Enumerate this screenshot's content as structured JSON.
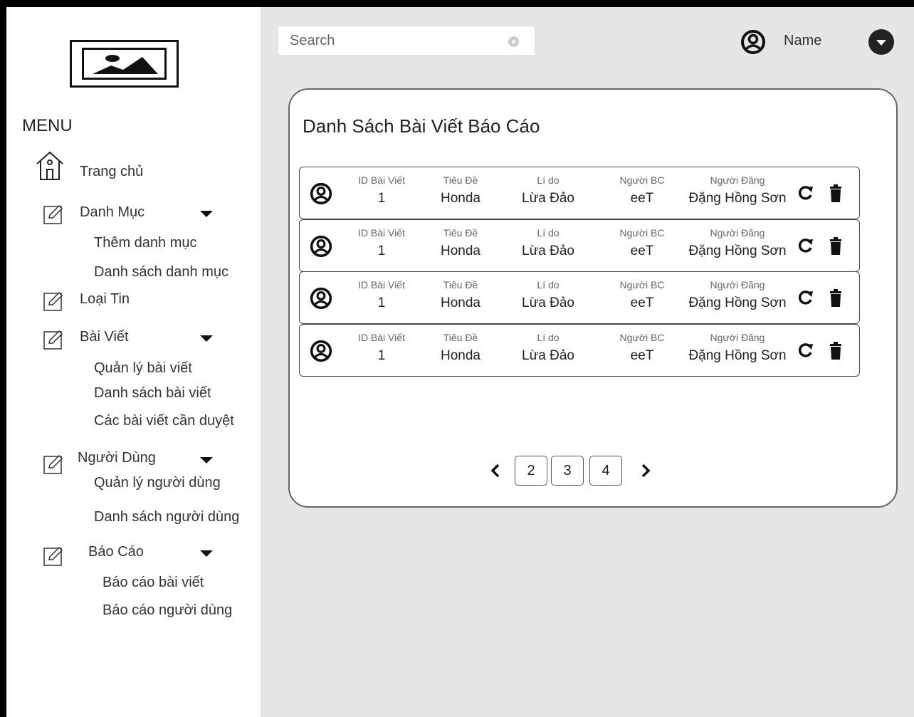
{
  "sidebar": {
    "menu_title": "MENU",
    "home_label": "Trang chủ",
    "categories": {
      "label": "Danh Mục",
      "items": [
        "Thêm danh mục",
        "Danh sách danh mục"
      ]
    },
    "news_type_label": "Loại Tin",
    "posts": {
      "label": "Bài Viết",
      "items": [
        "Quản lý bài viết",
        "Danh sách bài viết",
        "Các bài viết cần duyệt"
      ]
    },
    "users": {
      "label": "Người Dùng",
      "items": [
        "Quản lý người dùng",
        "Danh sách người dùng"
      ]
    },
    "reports": {
      "label": "Báo Cáo",
      "items": [
        "Báo cáo bài viết",
        "Báo cáo người dùng"
      ]
    }
  },
  "header": {
    "search_placeholder": "Search",
    "user_name": "Name"
  },
  "main": {
    "title": "Danh Sách Bài Viết Báo Cáo",
    "columns": [
      "ID Bài Viết",
      "Tiêu Đề",
      "Lí do",
      "Người BC",
      "Người Đăng"
    ],
    "rows": [
      {
        "id": "1",
        "title": "Honda",
        "reason": "Lừa Đảo",
        "reporter": "eeT",
        "poster": "Đặng Hồng Sơn"
      },
      {
        "id": "1",
        "title": "Honda",
        "reason": "Lừa Đảo",
        "reporter": "eeT",
        "poster": "Đặng Hồng Sơn"
      },
      {
        "id": "1",
        "title": "Honda",
        "reason": "Lừa Đảo",
        "reporter": "eeT",
        "poster": "Đặng Hồng Sơn"
      },
      {
        "id": "1",
        "title": "Honda",
        "reason": "Lừa Đảo",
        "reporter": "eeT",
        "poster": "Đặng Hồng Sơn"
      }
    ],
    "pagination": [
      "2",
      "3",
      "4"
    ]
  }
}
